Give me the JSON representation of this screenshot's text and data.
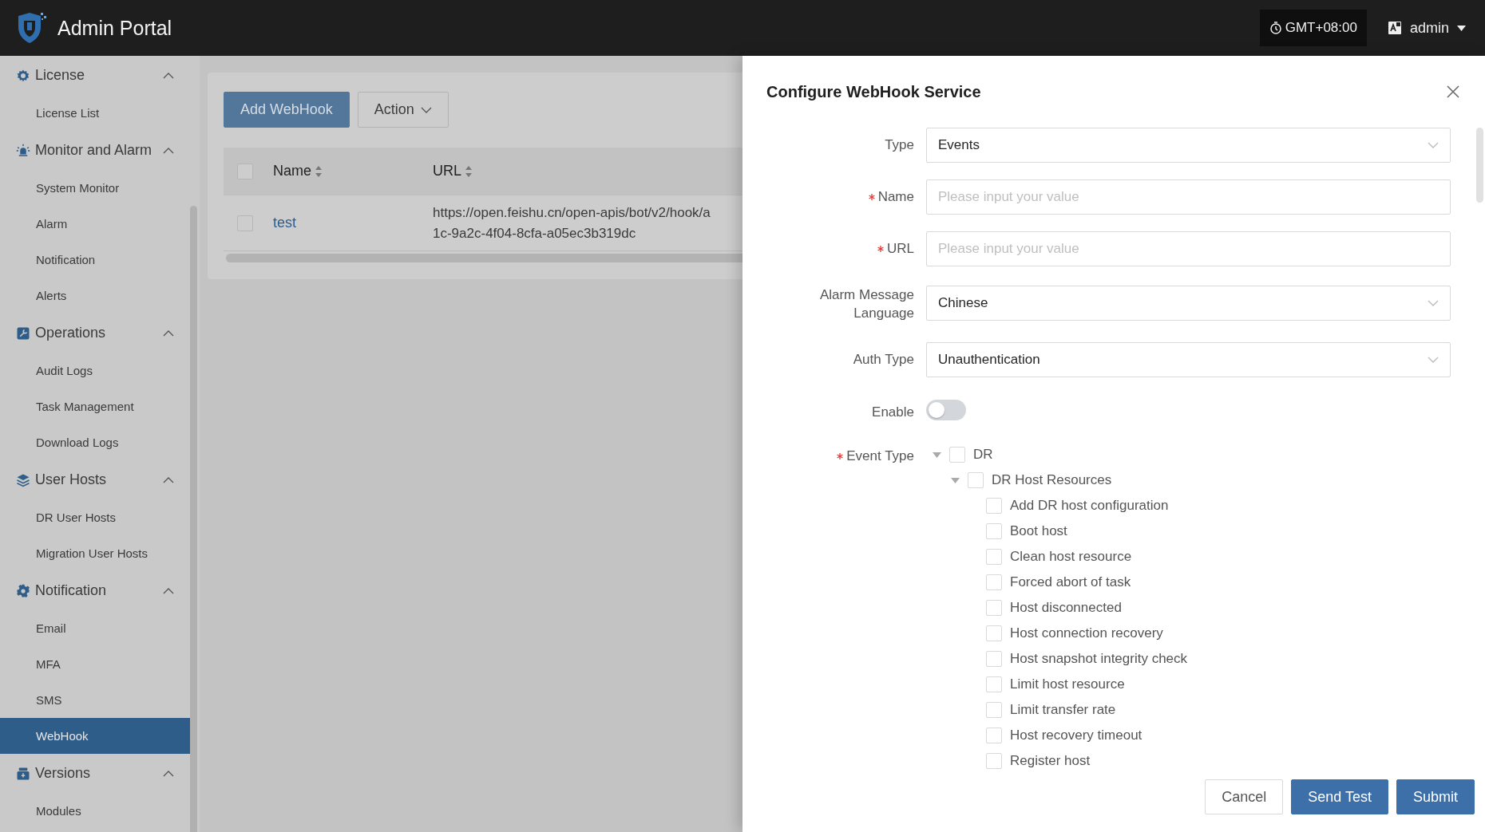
{
  "header": {
    "title": "Admin Portal",
    "timezone": "GMT+08:00",
    "user": "admin"
  },
  "sidebar": {
    "groups": [
      {
        "label": "License",
        "expanded": true,
        "items": [
          {
            "label": "License List",
            "selected": false
          }
        ]
      },
      {
        "label": "Monitor and Alarm",
        "expanded": true,
        "items": [
          {
            "label": "System Monitor",
            "selected": false
          },
          {
            "label": "Alarm",
            "selected": false
          },
          {
            "label": "Notification",
            "selected": false
          },
          {
            "label": "Alerts",
            "selected": false
          }
        ]
      },
      {
        "label": "Operations",
        "expanded": true,
        "items": [
          {
            "label": "Audit Logs",
            "selected": false
          },
          {
            "label": "Task Management",
            "selected": false
          },
          {
            "label": "Download Logs",
            "selected": false
          }
        ]
      },
      {
        "label": "User Hosts",
        "expanded": true,
        "items": [
          {
            "label": "DR User Hosts",
            "selected": false
          },
          {
            "label": "Migration User Hosts",
            "selected": false
          }
        ]
      },
      {
        "label": "Notification",
        "expanded": true,
        "items": [
          {
            "label": "Email",
            "selected": false
          },
          {
            "label": "MFA",
            "selected": false
          },
          {
            "label": "SMS",
            "selected": false
          },
          {
            "label": "WebHook",
            "selected": true
          }
        ]
      },
      {
        "label": "Versions",
        "expanded": true,
        "items": [
          {
            "label": "Modules",
            "selected": false
          }
        ]
      }
    ]
  },
  "toolbar": {
    "buttons": [
      {
        "label": "Add WebHook",
        "kind": "primary"
      },
      {
        "label": "Action",
        "kind": "dropdown"
      }
    ]
  },
  "table": {
    "select_all_checked": false,
    "columns": [
      {
        "label": "Name"
      },
      {
        "label": "URL"
      }
    ],
    "rows": [
      {
        "checked": false,
        "name": "test",
        "url": [
          "https://open.feishu.cn/open-apis/bot/v2/hook/a",
          "1c-9a2c-4f04-8cfa-a05ec3b319dc"
        ]
      }
    ]
  },
  "drawer": {
    "title": "Configure WebHook Service",
    "fields": [
      {
        "kind": "select",
        "label": "Type",
        "required": false,
        "value": "Events"
      },
      {
        "kind": "input",
        "label": "Name",
        "required": true,
        "placeholder": "Please input your value"
      },
      {
        "kind": "input",
        "label": "URL",
        "required": true,
        "placeholder": "Please input your value"
      },
      {
        "kind": "select",
        "label": "Alarm Message Language",
        "required": false,
        "value": "Chinese"
      },
      {
        "kind": "select",
        "label": "Auth Type",
        "required": false,
        "value": "Unauthentication"
      },
      {
        "kind": "switch",
        "label": "Enable",
        "required": false,
        "on": false
      },
      {
        "kind": "tree",
        "label": "Event Type",
        "required": true,
        "nodes": [
          {
            "label": "DR",
            "checked": false,
            "expanded": true,
            "children": [
              {
                "label": "DR Host Resources",
                "checked": false,
                "expanded": true,
                "children": [
                  {
                    "label": "Add DR host configuration",
                    "checked": false
                  },
                  {
                    "label": "Boot host",
                    "checked": false
                  },
                  {
                    "label": "Clean host resource",
                    "checked": false
                  },
                  {
                    "label": "Forced abort of task",
                    "checked": false
                  },
                  {
                    "label": "Host disconnected",
                    "checked": false
                  },
                  {
                    "label": "Host connection recovery",
                    "checked": false
                  },
                  {
                    "label": "Host snapshot integrity check",
                    "checked": false
                  },
                  {
                    "label": "Limit host resource",
                    "checked": false
                  },
                  {
                    "label": "Limit transfer rate",
                    "checked": false
                  },
                  {
                    "label": "Host recovery timeout",
                    "checked": false
                  },
                  {
                    "label": "Register host",
                    "checked": false
                  }
                ]
              }
            ]
          }
        ]
      }
    ],
    "buttons": [
      {
        "label": "Cancel",
        "kind": "default"
      },
      {
        "label": "Send Test",
        "kind": "primary"
      },
      {
        "label": "Submit",
        "kind": "primary"
      }
    ]
  }
}
